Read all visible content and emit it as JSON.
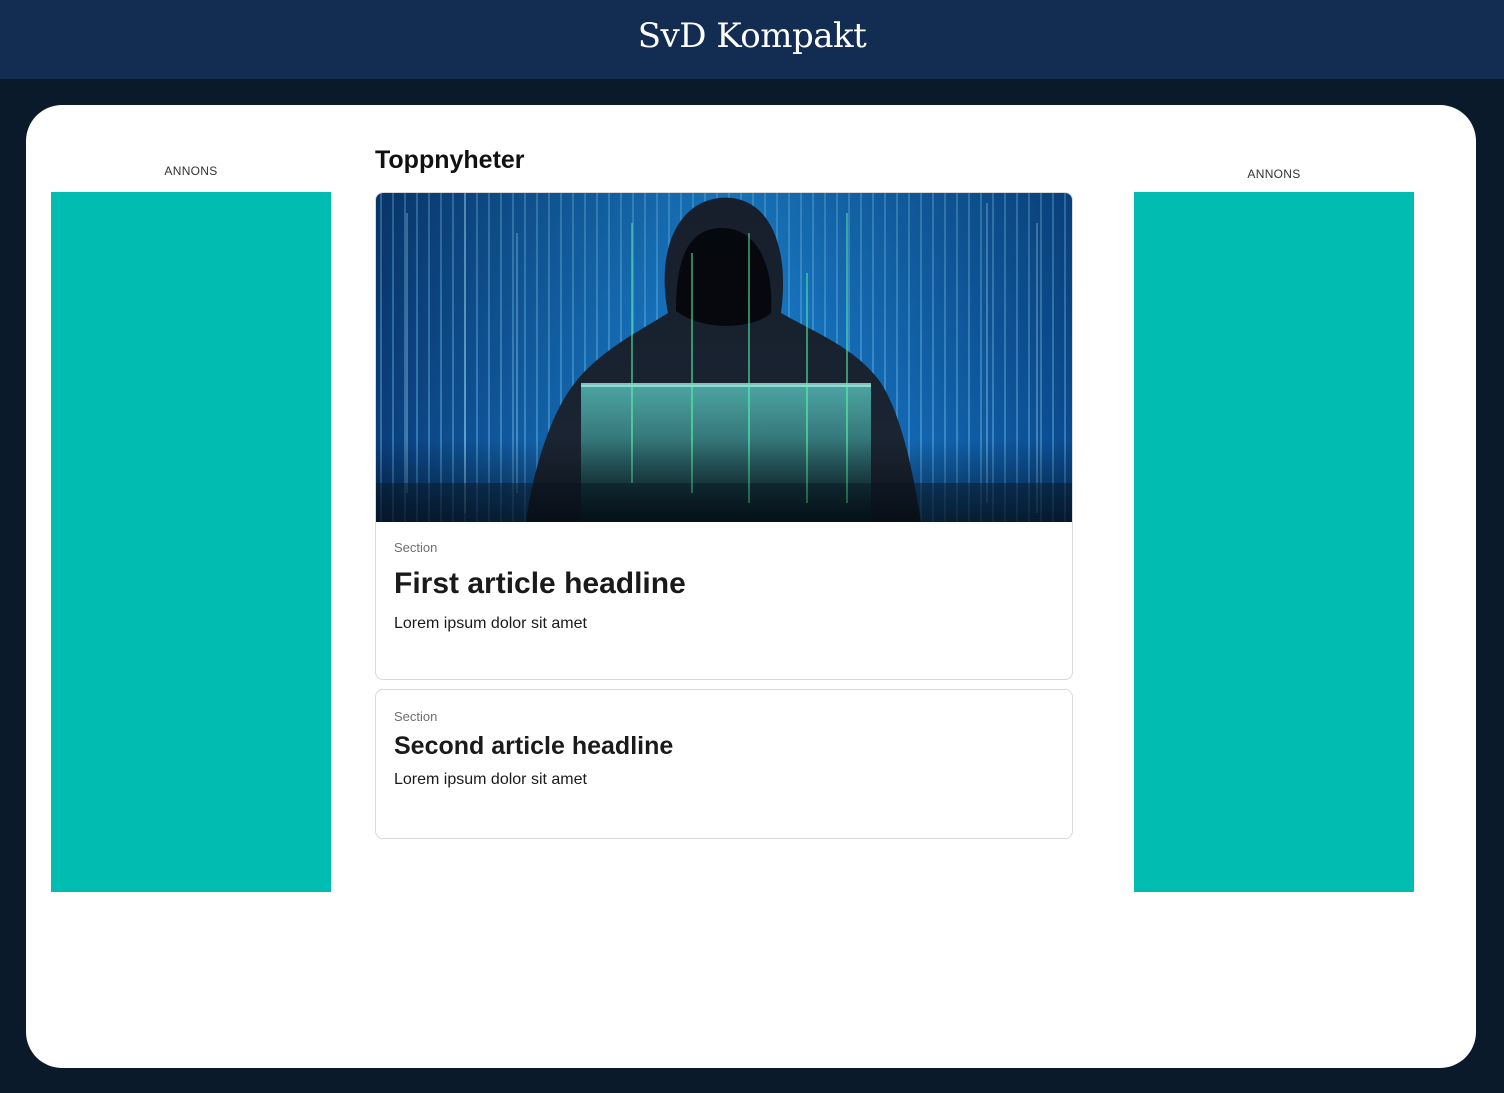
{
  "header": {
    "brand": "SvD Kompakt"
  },
  "ads": {
    "left_label": "ANNONS",
    "right_label": "ANNONS",
    "color": "#00bcb1"
  },
  "main": {
    "title": "Toppnyheter",
    "articles": [
      {
        "section": "Section",
        "headline": "First article headline",
        "lede": "Lorem ipsum dolor sit amet",
        "image": "hooded-hacker-laptop-binary-code"
      },
      {
        "section": "Section",
        "headline": "Second article headline",
        "lede": "Lorem ipsum dolor sit amet"
      }
    ]
  },
  "colors": {
    "header_bg": "#132d52",
    "page_bg": "#0b1a2a",
    "panel_bg": "#ffffff"
  }
}
